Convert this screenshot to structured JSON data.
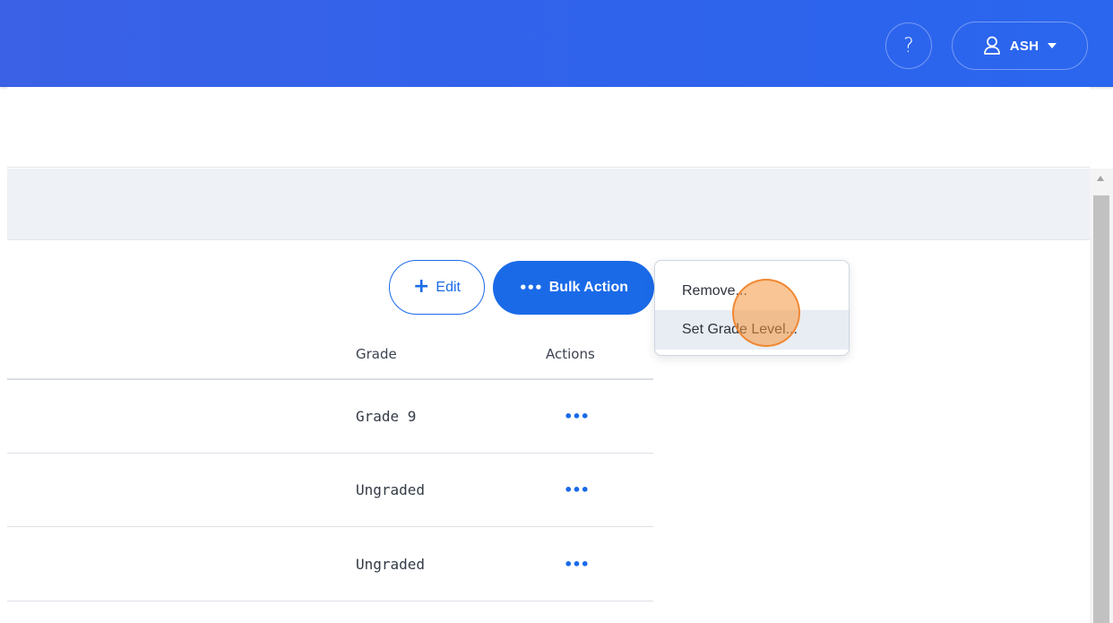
{
  "topbar": {
    "help_glyph": "?",
    "user_name": "ASH",
    "icons": {
      "help": "question-icon",
      "user": "user-icon",
      "caret": "caret-down-icon"
    },
    "color": "#2f63ec"
  },
  "toolbar": {
    "edit_label": "Edit",
    "edit_icon": "plus-icon",
    "bulk_label": "Bulk Action",
    "bulk_icon": "ellipsis-icon"
  },
  "bulk_menu": {
    "items": [
      {
        "label": "Remove..."
      },
      {
        "label": "Set Grade Level..."
      }
    ],
    "hovered_index": 1
  },
  "table": {
    "columns": [
      "Grade",
      "Actions"
    ],
    "rows": [
      {
        "grade": "Grade 9",
        "actions_glyph": "•••"
      },
      {
        "grade": "Ungraded",
        "actions_glyph": "•••"
      },
      {
        "grade": "Ungraded",
        "actions_glyph": "•••"
      }
    ]
  },
  "colors": {
    "accent": "#1a6ae8",
    "topbar": "#2f63ec",
    "cursor_highlight": "#f5963c"
  }
}
